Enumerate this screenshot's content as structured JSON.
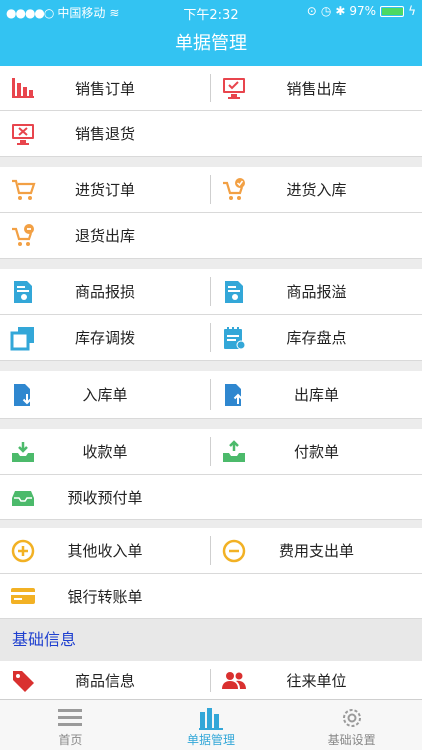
{
  "status_bar": {
    "carrier": "中国移动",
    "time": "下午2:32",
    "battery": "97%",
    "battery_level": 0.97
  },
  "header": {
    "title": "单据管理"
  },
  "rows": {
    "sales_order": "销售订单",
    "sales_out": "销售出库",
    "sales_return": "销售退货",
    "purchase_order": "进货订单",
    "purchase_in": "进货入库",
    "purchase_return": "退货出库",
    "goods_loss": "商品报损",
    "goods_overflow": "商品报溢",
    "stock_transfer": "库存调拨",
    "stock_count": "库存盘点",
    "in_order": "入库单",
    "out_order": "出库单",
    "receipt": "收款单",
    "payment": "付款单",
    "prepaid": "预收预付单",
    "other_income": "其他收入单",
    "expense": "费用支出单",
    "bank_transfer": "银行转账单",
    "goods_info": "商品信息",
    "contacts": "往来单位"
  },
  "section": {
    "basic_info": "基础信息"
  },
  "tabs": {
    "home": "首页",
    "docs": "单据管理",
    "settings": "基础设置"
  },
  "colors": {
    "accent": "#33c3f2",
    "red": "#e8454d",
    "orange": "#f2a044",
    "blue": "#2f87cf",
    "green": "#4cba6b",
    "yellow": "#f2b124",
    "section_text": "#1e3fcf"
  }
}
